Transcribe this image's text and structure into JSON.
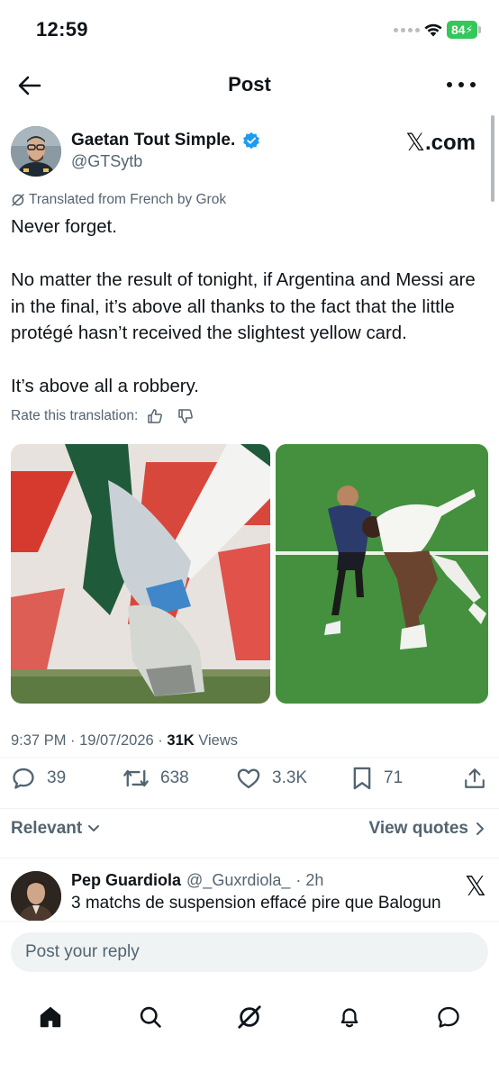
{
  "status_bar": {
    "time": "12:59",
    "battery": "84"
  },
  "nav": {
    "title": "Post"
  },
  "author": {
    "name": "Gaetan Tout Simple.",
    "handle": "@GTSytb",
    "source_badge": ".com"
  },
  "translation": {
    "note": "Translated from French by Grok",
    "rate_label": "Rate this translation:"
  },
  "post": {
    "paragraphs": [
      "Never forget.",
      "No matter the result of tonight, if Argentina and Messi are in the final, it’s above all thanks to the fact that the little protégé hasn’t received the slightest yellow card.",
      "It’s above all a robbery."
    ],
    "time": "9:37 PM",
    "date": "19/07/2026",
    "views_count": "31K",
    "views_label": "Views"
  },
  "actions": {
    "replies": "39",
    "reposts": "638",
    "likes": "3.3K",
    "bookmarks": "71"
  },
  "sort": {
    "label": "Relevant",
    "quotes_label": "View quotes"
  },
  "reply": {
    "name": "Pep Guardiola",
    "handle": "@_Guxrdiola_",
    "time": "· 2h",
    "text": "3 matchs de suspension effacé pire que Balogun"
  },
  "composer": {
    "placeholder": "Post your reply"
  },
  "tabs": [
    "home-icon",
    "search-icon",
    "grok-icon",
    "notifications-icon",
    "messages-icon"
  ],
  "colors": {
    "text": "#0f1419",
    "secondary": "#536471",
    "verified": "#1d9bf0",
    "battery": "#34c759"
  }
}
